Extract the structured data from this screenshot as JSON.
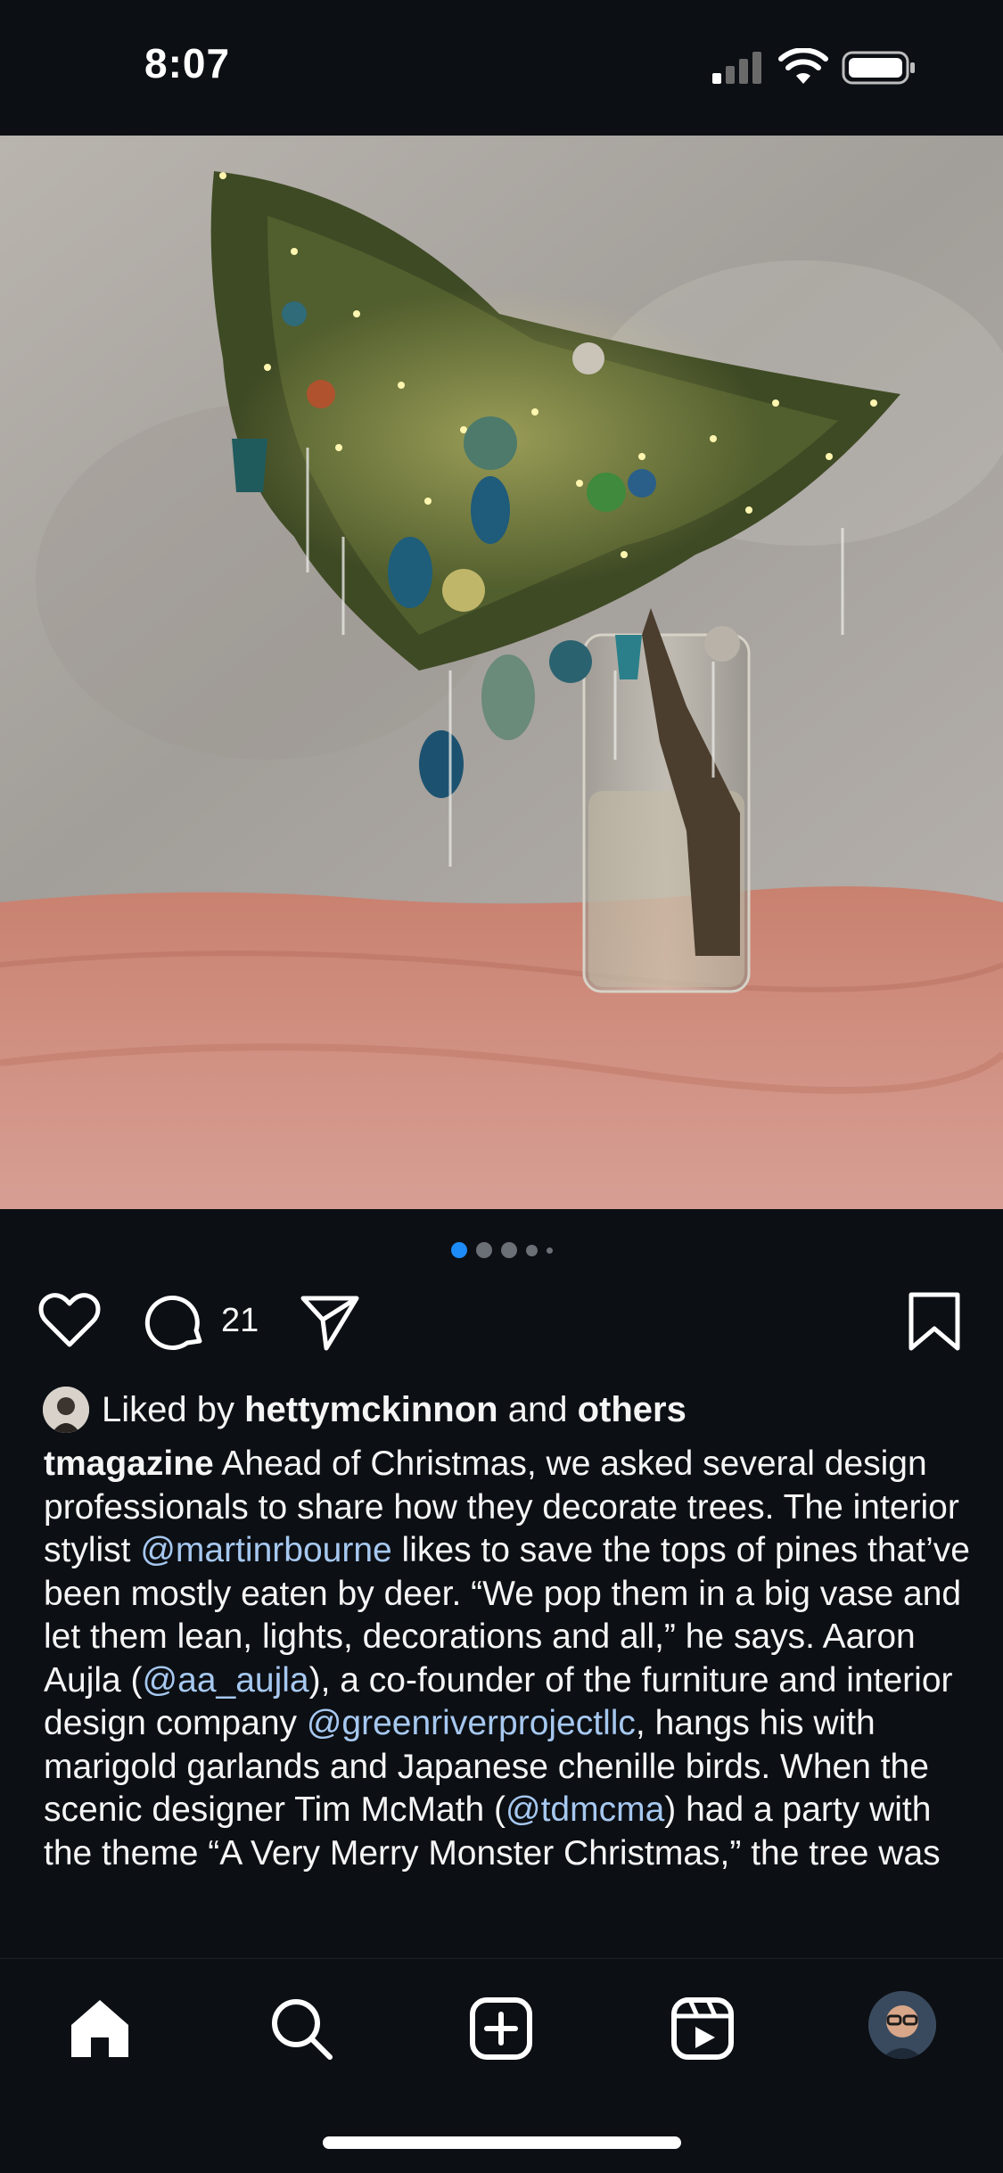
{
  "status_bar": {
    "time": "8:07",
    "icons": [
      "cellular-signal-icon",
      "wifi-icon",
      "battery-icon"
    ]
  },
  "post": {
    "image_alt": "Pine tree top decorated with lights and ornaments in a glass vase",
    "carousel": {
      "count": 5,
      "active_index": 0
    },
    "actions": {
      "like_icon": "heart-icon",
      "comment_icon": "comment-icon",
      "comment_count": "21",
      "share_icon": "send-icon",
      "save_icon": "bookmark-icon"
    },
    "likes": {
      "prefix": "Liked by",
      "user": "hettymckinnon",
      "connector": "and",
      "others": "others"
    },
    "caption": {
      "username": "tmagazine",
      "segments": [
        {
          "text": " Ahead of Christmas, we asked several design professionals to share how they decorate trees. The interior stylist ",
          "mention": false
        },
        {
          "text": "@martinrbourne",
          "mention": true
        },
        {
          "text": " likes to save the tops of pines that’ve been mostly eaten by deer. “We pop them in a big vase and let them lean, lights, decorations and all,” he says. Aaron Aujla (",
          "mention": false
        },
        {
          "text": "@aa_aujla",
          "mention": true
        },
        {
          "text": "), a co-founder of the furniture and interior design company ",
          "mention": false
        },
        {
          "text": "@greenriverprojectllc",
          "mention": true
        },
        {
          "text": ", hangs his with marigold garlands and Japanese chenille birds. When the scenic designer Tim McMath (",
          "mention": false
        },
        {
          "text": "@tdmcma",
          "mention": true
        },
        {
          "text": ") had a party with the theme “A Very Merry Monster Christmas,” the tree was",
          "mention": false
        }
      ]
    }
  },
  "tab_bar": {
    "tabs": [
      {
        "name": "home",
        "icon": "home-icon",
        "active": true
      },
      {
        "name": "search",
        "icon": "search-icon",
        "active": false
      },
      {
        "name": "create",
        "icon": "plus-square-icon",
        "active": false
      },
      {
        "name": "reels",
        "icon": "reels-icon",
        "active": false
      },
      {
        "name": "profile",
        "icon": "profile-avatar",
        "active": false
      }
    ]
  },
  "colors": {
    "background": "#0c0f14",
    "text": "#f5f5f5",
    "mention": "#a6c8f0",
    "carousel_active": "#1d8cf8"
  }
}
